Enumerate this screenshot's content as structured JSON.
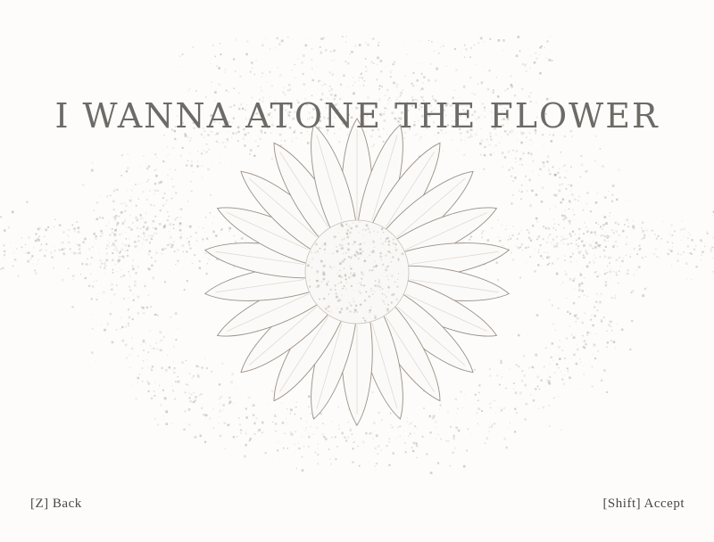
{
  "title": "I WANNA ATONE THE FLOWER",
  "controls": {
    "back_label": "[Z] Back",
    "accept_label": "[Shift] Accept"
  },
  "colors": {
    "background": "#fdfcfb",
    "title_text": "#6e6a66",
    "hint_text": "#4a4642",
    "speckle": "#b5aaa0",
    "flower_outline": "#9c8f84"
  },
  "icons": {
    "emblem": "daisy-flower-icon"
  }
}
